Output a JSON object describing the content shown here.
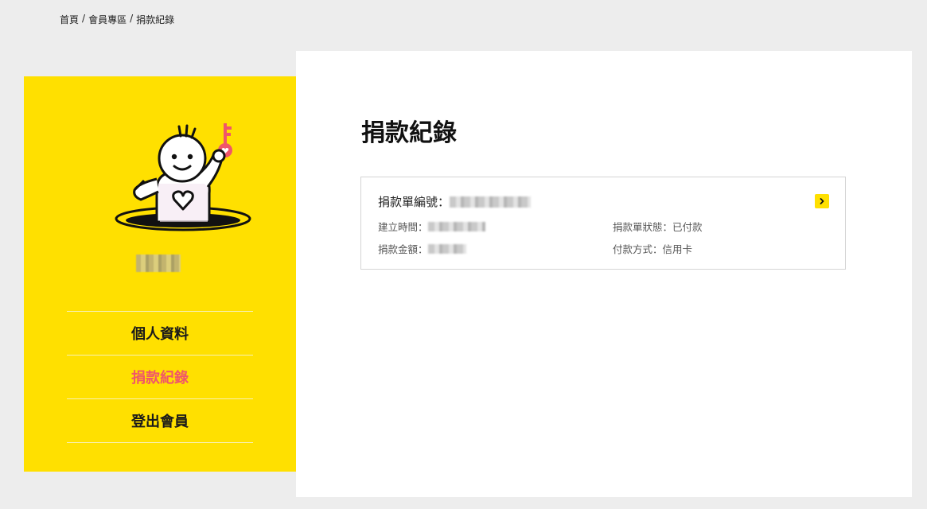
{
  "breadcrumb": {
    "items": [
      "首頁",
      "會員專區",
      "捐款紀錄"
    ],
    "separator": "/"
  },
  "sidebar": {
    "mascot_icon": "mascot-with-key-icon",
    "menu": [
      {
        "label": "個人資料",
        "active": false
      },
      {
        "label": "捐款紀錄",
        "active": true
      },
      {
        "label": "登出會員",
        "active": false
      }
    ]
  },
  "main": {
    "title": "捐款紀錄",
    "record": {
      "number_label": "捐款單編號：",
      "created_label": "建立時間：",
      "status_label": "捐款單狀態：",
      "status_value": "已付款",
      "amount_label": "捐款金額：",
      "payment_label": "付款方式：",
      "payment_value": "信用卡",
      "detail_icon": "chevron-right-icon"
    }
  },
  "colors": {
    "accent_yellow": "#ffe000",
    "active_pink": "#f0566a",
    "background": "#ededed"
  }
}
